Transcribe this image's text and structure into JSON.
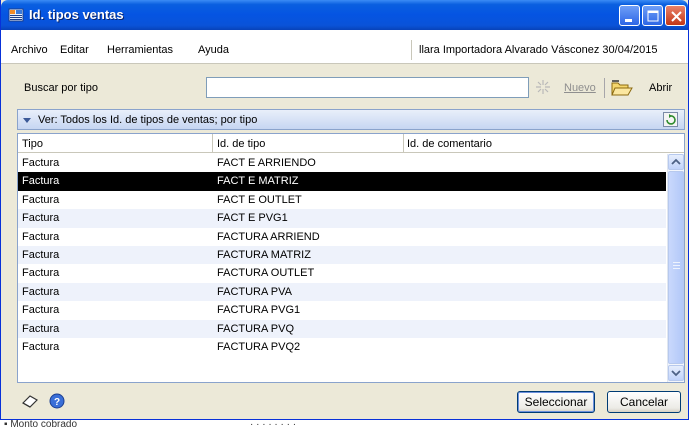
{
  "window": {
    "title": "Id. tipos ventas"
  },
  "menu": {
    "items": [
      "Archivo",
      "Editar",
      "Herramientas",
      "Ayuda"
    ],
    "info": "llara  Importadora Alvarado Vásconez  30/04/2015"
  },
  "search": {
    "label": "Buscar por tipo",
    "value": "",
    "new_label": "Nuevo",
    "open_label": "Abrir"
  },
  "view": {
    "label": "Ver: Todos los Id. de tipos de ventas; por tipo"
  },
  "grid": {
    "columns": [
      "Tipo",
      "Id. de tipo",
      "Id. de comentario"
    ],
    "selected_row": 1,
    "rows": [
      [
        "Factura",
        "FACT E ARRIENDO",
        ""
      ],
      [
        "Factura",
        "FACT E MATRIZ",
        ""
      ],
      [
        "Factura",
        "FACT E OUTLET",
        ""
      ],
      [
        "Factura",
        "FACT E PVG1",
        ""
      ],
      [
        "Factura",
        "FACTURA ARRIEND",
        ""
      ],
      [
        "Factura",
        "FACTURA MATRIZ",
        ""
      ],
      [
        "Factura",
        "FACTURA OUTLET",
        ""
      ],
      [
        "Factura",
        "FACTURA PVA",
        ""
      ],
      [
        "Factura",
        "FACTURA PVG1",
        ""
      ],
      [
        "Factura",
        "FACTURA PVQ",
        ""
      ],
      [
        "Factura",
        "FACTURA PVQ2",
        ""
      ]
    ]
  },
  "buttons": {
    "select": "Seleccionar",
    "cancel": "Cancelar"
  },
  "icons": {
    "app": "app-grid-icon",
    "new": "new-sparkle-icon",
    "open": "folder-open-icon",
    "refresh": "refresh-icon",
    "clear": "eraser-icon",
    "help": "help-icon"
  },
  "colors": {
    "titlebar": "#0554E2",
    "selection": "#000000",
    "alt_row": "#EEF2FB",
    "view_bar": "#C6D6F2"
  }
}
